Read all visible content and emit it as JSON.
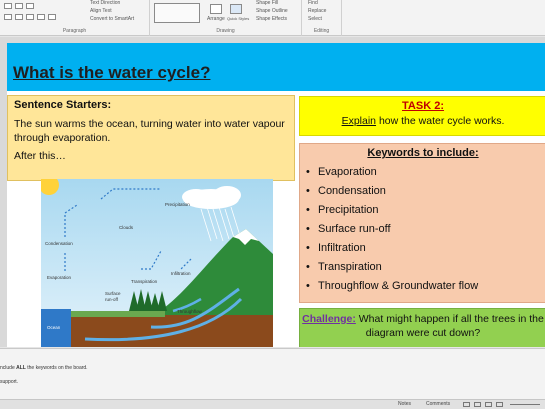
{
  "ribbon": {
    "para_items": [
      "Text Direction",
      "Align Text",
      "Convert to SmartArt"
    ],
    "paragraph_label": "Paragraph",
    "drawing_label": "Drawing",
    "editing_label": "Editing",
    "arrange_label": "Arrange",
    "quick_styles_label": "Quick Styles",
    "shape_fill": "Shape Fill",
    "shape_outline": "Shape Outline",
    "shape_effects": "Shape Effects",
    "find": "Find",
    "replace": "Replace",
    "select": "Select"
  },
  "slide": {
    "title": "What is the water cycle?",
    "starters": {
      "heading": "Sentence Starters:",
      "body": "The sun warms the ocean, turning water into water vapour through evaporation.",
      "after": "After this…"
    },
    "task": {
      "heading": "TASK 2:",
      "verb": "Explain",
      "rest": " how the water cycle works."
    },
    "keywords": {
      "heading": "Keywords to include:",
      "items": [
        "Evaporation",
        "Condensation",
        "Precipitation",
        "Surface run-off",
        "Infiltration",
        "Transpiration",
        "Throughflow & Groundwater flow"
      ]
    },
    "challenge": {
      "label": "Challenge:",
      "text": " What might happen if all the trees in the diagram were cut down?"
    },
    "diagram_labels": {
      "precipitation": "Precipitation",
      "clouds": "Clouds",
      "condensation": "Condensation",
      "evaporation": "Evaporation",
      "transpiration": "Transpiration",
      "infiltration": "Infiltration",
      "surface": "Surface",
      "runoff": "run-off",
      "throughflow": "Throughflow",
      "ocean": "Ocean"
    }
  },
  "notes": {
    "line1_pre": "nclude ",
    "line1_bold": "ALL",
    "line1_post": " the keywords on the board.",
    "line2": "support."
  },
  "status": {
    "notes": "Notes",
    "comments": "Comments"
  }
}
